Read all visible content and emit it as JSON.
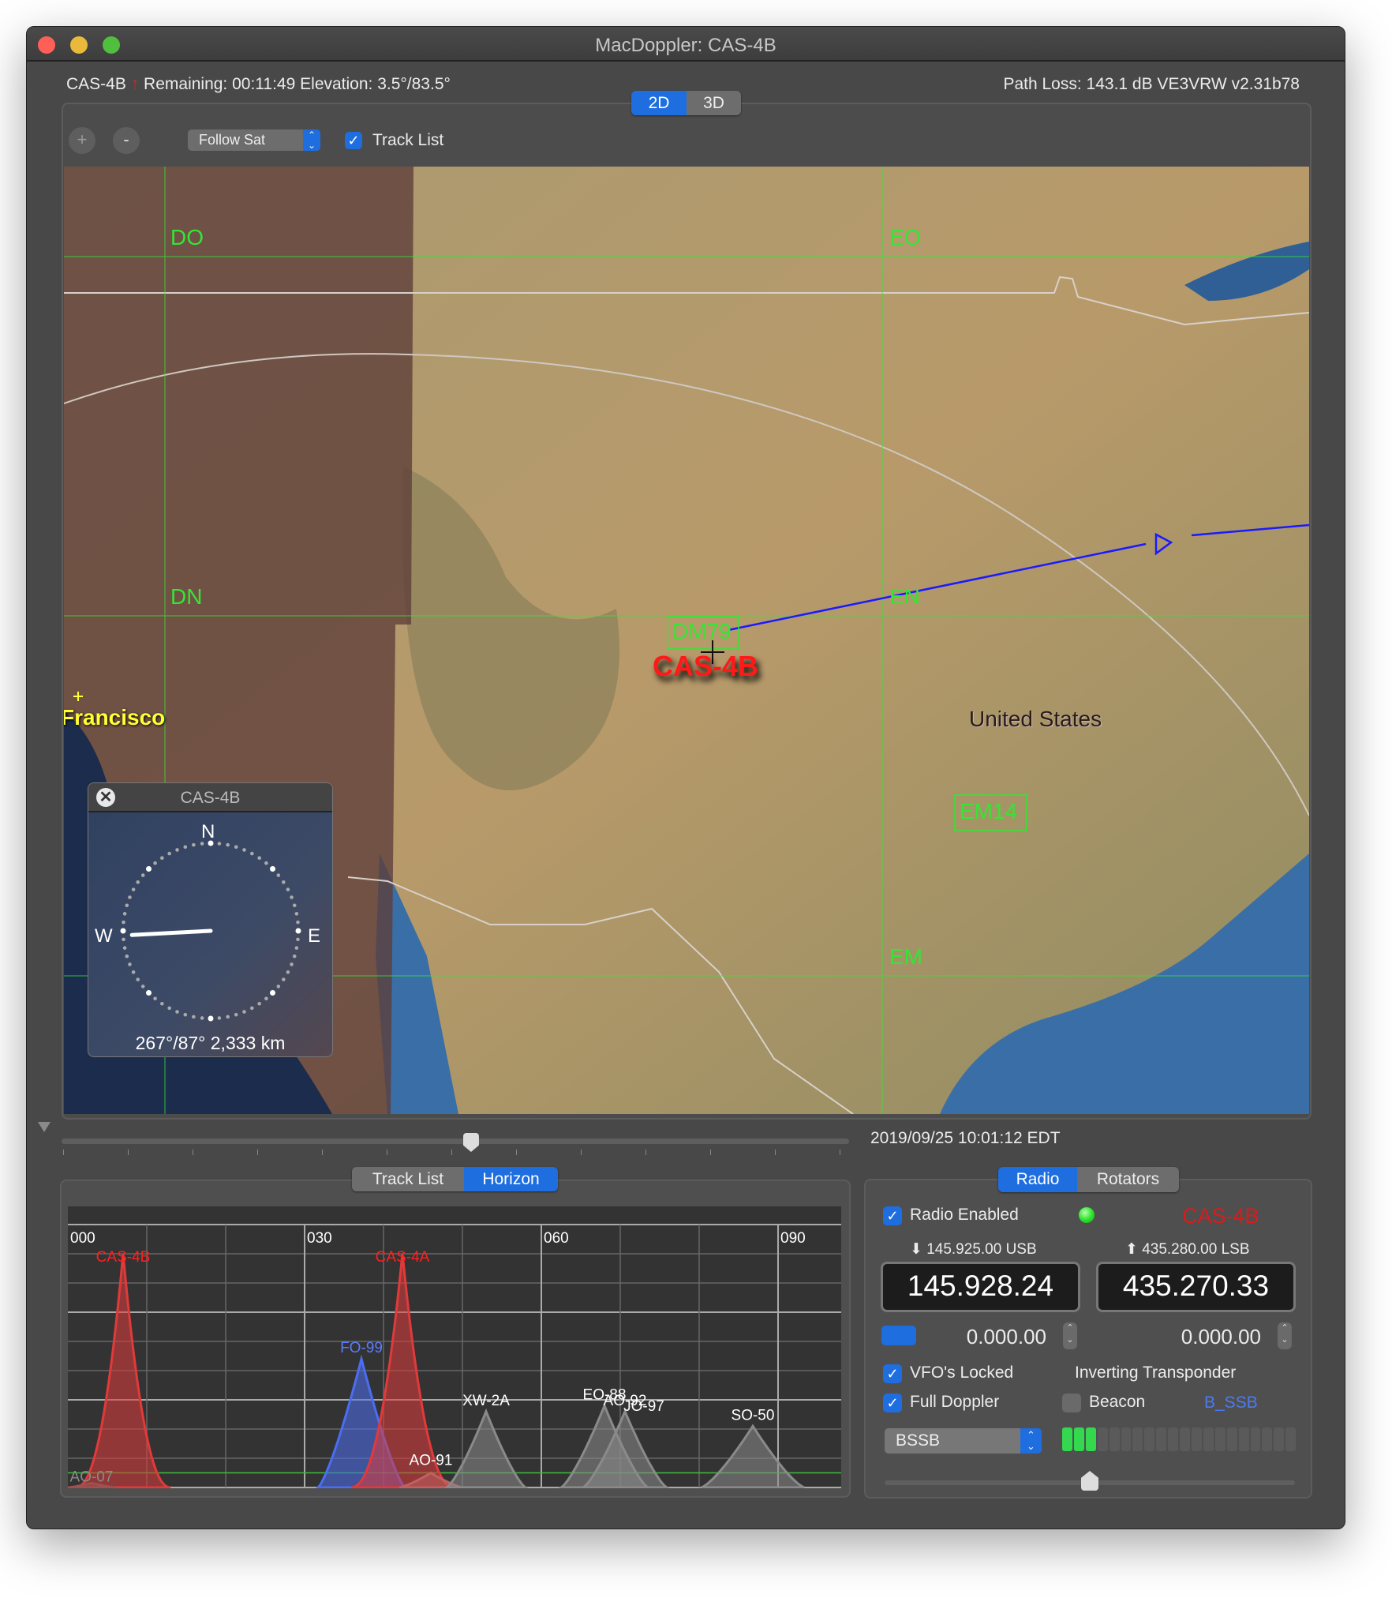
{
  "window": {
    "title": "MacDoppler: CAS-4B"
  },
  "status": {
    "satellite": "CAS-4B",
    "remaining": "Remaining: 00:11:49",
    "elevation": "Elevation: 3.5°/83.5°",
    "right": "Path Loss: 143.1 dB VE3VRW v2.31b78"
  },
  "view_tabs": [
    {
      "label": "2D",
      "active": true
    },
    {
      "label": "3D",
      "active": false
    }
  ],
  "toolbar": {
    "zoom_in": "+",
    "zoom_out": "-",
    "follow_select": "Follow Sat",
    "track_list_label": "Track List",
    "track_list_checked": true
  },
  "map": {
    "grid_labels": [
      "DO",
      "EO",
      "DN",
      "EN",
      "EM"
    ],
    "locator_boxes": [
      "DM79",
      "EM14"
    ],
    "satellite_label": "CAS-4B",
    "country_label": "United States",
    "city_label": "Francisco",
    "colors": {
      "grid": "#33e633",
      "track": "#1a1aff",
      "satellite": "#ff1a1a",
      "city": "#ffff33"
    }
  },
  "compass": {
    "title": "CAS-4B",
    "n": "N",
    "e": "E",
    "w": "W",
    "azimuth": 267,
    "readout": "267°/87° 2,333 km"
  },
  "timeline": {
    "datetime": "2019/09/25 10:01:12 EDT",
    "position": 0.52
  },
  "bottom_tabs": [
    {
      "label": "Track List",
      "active": false
    },
    {
      "label": "Horizon",
      "active": true
    }
  ],
  "chart_data": {
    "type": "area",
    "xlabel": "",
    "ylabel": "",
    "xlim": [
      0,
      98
    ],
    "ylim": [
      0,
      90
    ],
    "x_tick_labels": [
      "000",
      "030",
      "060",
      "090"
    ],
    "x_ticks": [
      0,
      30,
      60,
      90
    ],
    "min_elevation_line": 5,
    "grid": true,
    "series": [
      {
        "name": "CAS-4B",
        "azimuth": 7,
        "half_width": 6,
        "max_elevation": 80,
        "color": "#e03a3a",
        "label_color": "#ff2020"
      },
      {
        "name": "AO-07",
        "azimuth": 3,
        "half_width": 3,
        "max_elevation": 1.5,
        "color": "#a05050",
        "label_color": "#8a8a8a"
      },
      {
        "name": "FO-99",
        "azimuth": 37.2,
        "half_width": 5.5,
        "max_elevation": 44,
        "color": "#4a6ef0",
        "label_color": "#5a7cff"
      },
      {
        "name": "CAS-4A",
        "azimuth": 42.4,
        "half_width": 6.5,
        "max_elevation": 80,
        "color": "#e03a3a",
        "label_color": "#ff2020"
      },
      {
        "name": "AO-91",
        "azimuth": 46,
        "half_width": 4,
        "max_elevation": 5,
        "color": "#c06060",
        "label_color": "#ffffff"
      },
      {
        "name": "XW-2A",
        "azimuth": 53,
        "half_width": 5,
        "max_elevation": 26,
        "color": "#8a8a8a",
        "label_color": "#ffffff"
      },
      {
        "name": "EO-88",
        "azimuth": 68,
        "half_width": 5.5,
        "max_elevation": 28,
        "color": "#8a8a8a",
        "label_color": "#ffffff"
      },
      {
        "name": "AO-92",
        "azimuth": 70.6,
        "half_width": 5.3,
        "max_elevation": 26,
        "color": "#8a8a8a",
        "label_color": "#ffffff"
      },
      {
        "name": "JO-97",
        "azimuth": 73,
        "half_width": 5.7,
        "max_elevation": 24,
        "color": "#8a8a8a",
        "label_color": "#ffffff"
      },
      {
        "name": "SO-50",
        "azimuth": 86.8,
        "half_width": 6.5,
        "max_elevation": 21,
        "color": "#8a8a8a",
        "label_color": "#ffffff"
      }
    ]
  },
  "radio_tabs": [
    {
      "label": "Radio",
      "active": true
    },
    {
      "label": "Rotators",
      "active": false
    }
  ],
  "radio": {
    "enabled_label": "Radio Enabled",
    "enabled": true,
    "status_led": "#2ee62e",
    "satellite": "CAS-4B",
    "downlink_label": "145.925.00 USB",
    "uplink_label": "435.280.00 LSB",
    "downlink_freq": "145.928.24",
    "uplink_freq": "435.270.33",
    "down_offset": "0.000.00",
    "up_offset": "0.000.00",
    "vfo_locked_label": "VFO's Locked",
    "vfo_locked": true,
    "transponder": "Inverting Transponder",
    "full_doppler_label": "Full Doppler",
    "full_doppler": true,
    "beacon_label": "Beacon",
    "beacon": false,
    "mode_tag": "B_SSB",
    "mode_select": "BSSB",
    "meter_level": 3,
    "meter_segments": 20,
    "slider": 0.5
  }
}
